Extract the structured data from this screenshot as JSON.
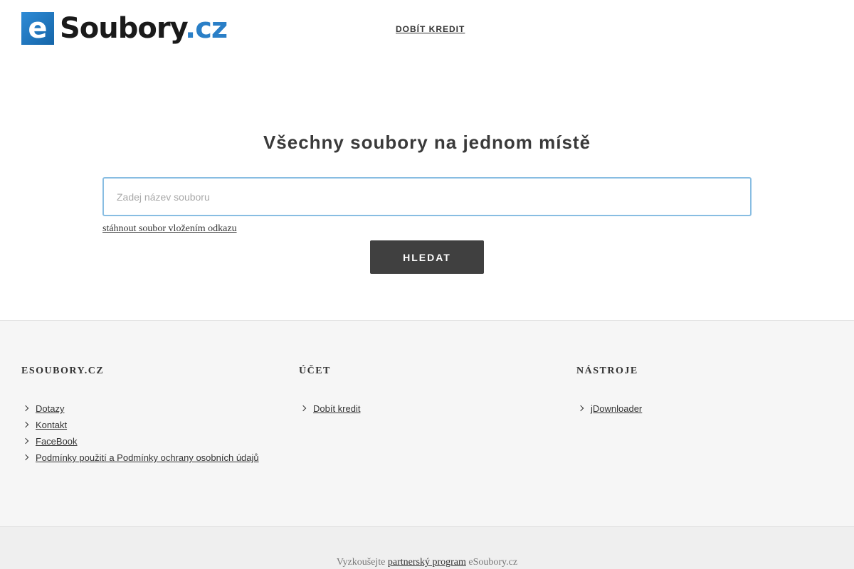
{
  "header": {
    "logo_e": "e",
    "logo_name": "Soubory",
    "logo_tld": ".cz",
    "nav_link": "DOBÍT KREDIT"
  },
  "main": {
    "title": "Všechny soubory na jednom místě",
    "search_placeholder": "Zadej název souboru",
    "download_link": "stáhnout soubor vložením odkazu",
    "search_button": "HLEDAT"
  },
  "footer": {
    "columns": [
      {
        "heading": "ESOUBORY.CZ",
        "links": [
          "Dotazy",
          "Kontakt",
          "FaceBook",
          "Podmínky použití a Podmínky ochrany osobních údajů"
        ]
      },
      {
        "heading": "ÚČET",
        "links": [
          "Dobít kredit"
        ]
      },
      {
        "heading": "NÁSTROJE",
        "links": [
          "jDownloader"
        ]
      }
    ]
  },
  "bottom": {
    "prefix": "Vyzkoušejte",
    "link": "partnerský program",
    "suffix": "eSoubory.cz"
  },
  "colors": {
    "brand_blue": "#2a7fc7",
    "button_dark": "#404040",
    "input_border": "#88bde2"
  }
}
